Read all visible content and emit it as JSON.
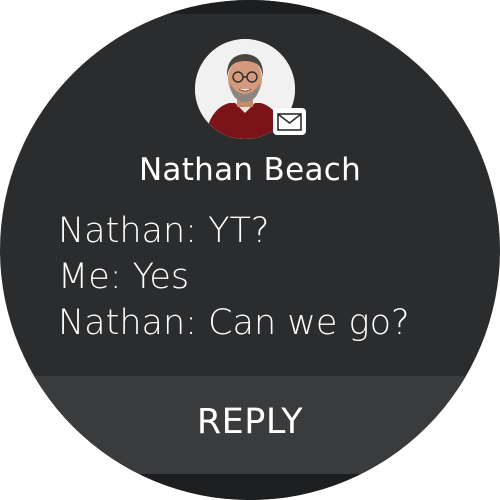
{
  "notification": {
    "sender_name": "Nathan Beach",
    "avatar_icon": "person-photo",
    "badge_icon": "mail-icon",
    "messages": [
      "Nathan: YT?",
      "Me: Yes",
      "Nathan: Can we go?"
    ],
    "action_label": "REPLY"
  },
  "colors": {
    "watch_background": "#2b2c2e",
    "action_bar": "#3a3b3d",
    "text": "#ffffff"
  }
}
